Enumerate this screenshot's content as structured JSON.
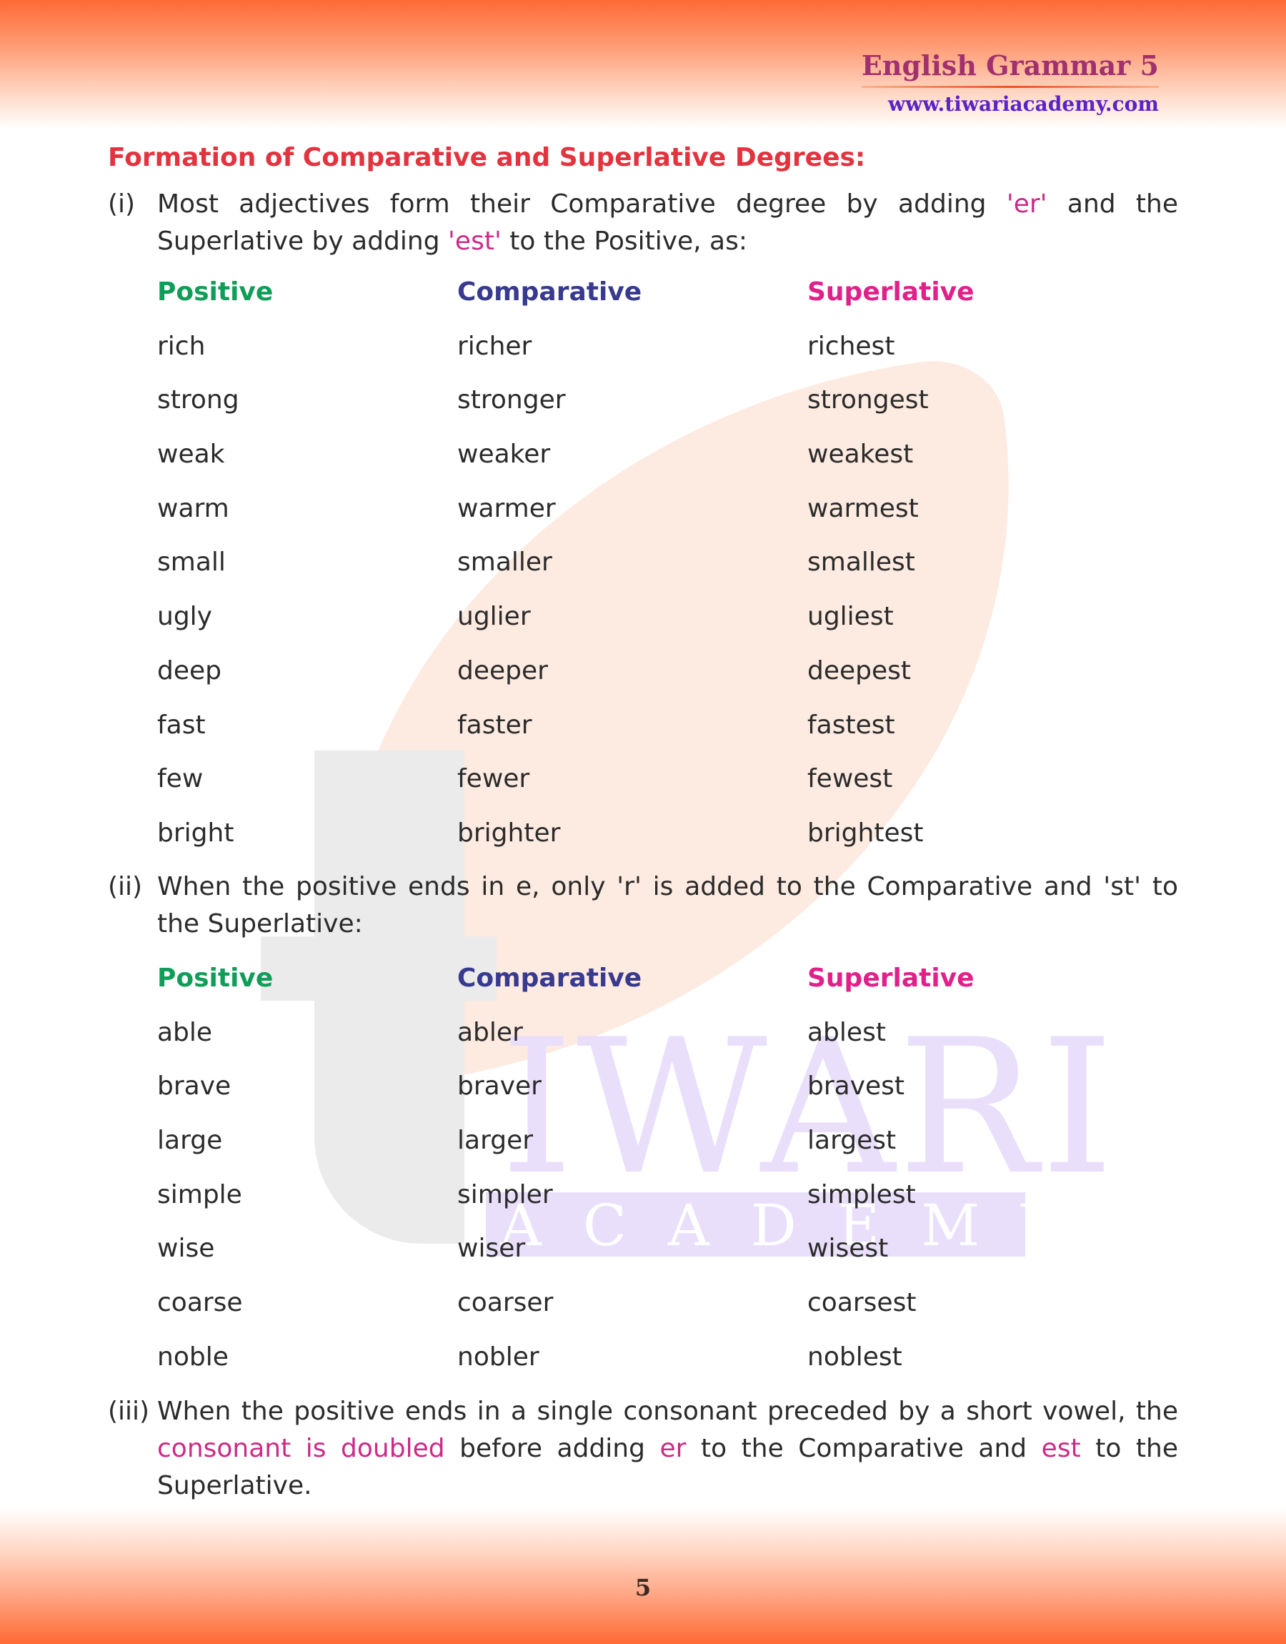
{
  "header": {
    "title": "English Grammar 5",
    "url": "www.tiwariacademy.com"
  },
  "watermark": {
    "line1": "IWARI",
    "line2": "ACADEMY"
  },
  "section": {
    "heading": "Formation of Comparative and Superlative Degrees:"
  },
  "rule1": {
    "number": "(i)",
    "parts": [
      "Most adjectives form their Comparative degree by adding ",
      "'er'",
      " and the Superlative by adding ",
      "'est'",
      " to the Positive, as:"
    ]
  },
  "table1": {
    "headers": [
      "Positive",
      "Comparative",
      "Superlative"
    ],
    "rows": [
      [
        "rich",
        "richer",
        "richest"
      ],
      [
        "strong",
        "stronger",
        "strongest"
      ],
      [
        "weak",
        "weaker",
        "weakest"
      ],
      [
        "warm",
        "warmer",
        "warmest"
      ],
      [
        "small",
        "smaller",
        "smallest"
      ],
      [
        "ugly",
        "uglier",
        "ugliest"
      ],
      [
        "deep",
        "deeper",
        "deepest"
      ],
      [
        "fast",
        "faster",
        "fastest"
      ],
      [
        "few",
        "fewer",
        "fewest"
      ],
      [
        "bright",
        "brighter",
        "brightest"
      ]
    ]
  },
  "rule2": {
    "number": "(ii)",
    "text": "When the positive ends in e, only 'r' is added to the Comparative and 'st' to the Superlative:"
  },
  "table2": {
    "headers": [
      "Positive",
      "Comparative",
      "Superlative"
    ],
    "rows": [
      [
        "able",
        "abler",
        "ablest"
      ],
      [
        "brave",
        "braver",
        "bravest"
      ],
      [
        "large",
        "larger",
        "largest"
      ],
      [
        "simple",
        "simpler",
        "simplest"
      ],
      [
        "wise",
        "wiser",
        "wisest"
      ],
      [
        "coarse",
        "coarser",
        "coarsest"
      ],
      [
        "noble",
        "nobler",
        "noblest"
      ]
    ]
  },
  "rule3": {
    "number": "(iii)",
    "parts": [
      "When the positive ends in a single consonant preceded by a short vowel, the ",
      "consonant is doubled",
      " before adding ",
      "er",
      " to the Comparative and ",
      "est",
      " to the Superlative."
    ]
  },
  "footer": {
    "page_number": "5"
  },
  "colors": {
    "heading": "#e2343f",
    "positive": "#0f9d58",
    "comparative": "#373a8e",
    "superlative": "#e0218a",
    "highlight": "#cc2a86",
    "band": "#ff6a35"
  }
}
